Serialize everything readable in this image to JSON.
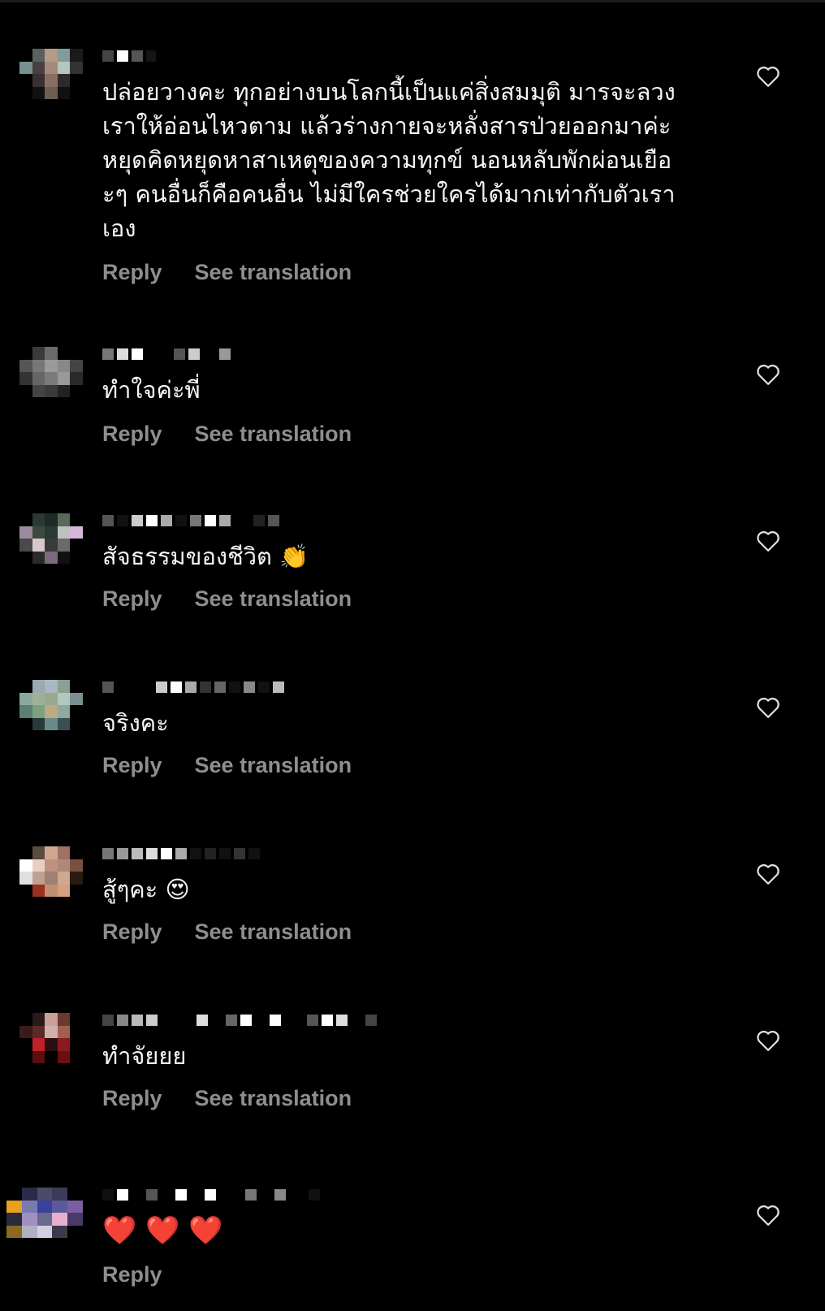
{
  "colors": {
    "background": "#000000",
    "text": "#f5f5f5",
    "secondary": "#8e8e8e"
  },
  "comments": [
    {
      "text": "ปล่อยวางคะ ทุกอย่างบนโลกนี้เป็นแค่สิ่งสมมุติ มารจะลวงเราให้อ่อนไหวตาม แล้วร่างกายจะหลั่งสารป่วยออกมาค่ะ หยุดคิดหยุดหาสาเหตุของความทุกข์ นอนหลับพักผ่อนเยือะๆ คนอื่นก็คือคนอื่น ไม่มีใครช่วยใครได้มากเท่ากับตัวเราเอง",
      "reply": "Reply",
      "translate": "See translation"
    },
    {
      "text": "ทำใจค่ะพี่",
      "reply": "Reply",
      "translate": "See translation"
    },
    {
      "text": "สัจธรรมของชีวิต 👏",
      "reply": "Reply",
      "translate": "See translation"
    },
    {
      "text": "จริงคะ",
      "reply": "Reply",
      "translate": "See translation"
    },
    {
      "text": "สู้ๆคะ 😍",
      "reply": "Reply",
      "translate": "See translation"
    },
    {
      "text": "ทำจัยยย",
      "reply": "Reply",
      "translate": "See translation"
    },
    {
      "text": "❤️ ❤️ ❤️",
      "reply": "Reply"
    }
  ]
}
